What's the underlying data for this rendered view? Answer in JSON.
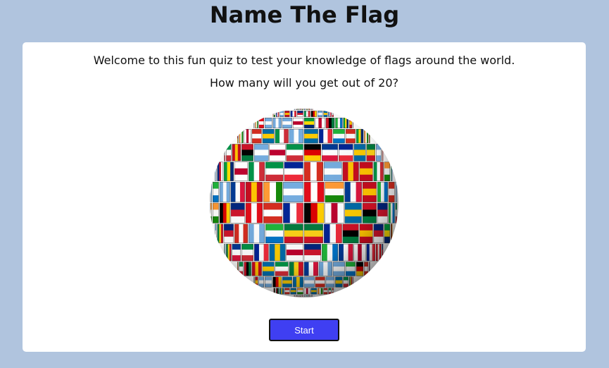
{
  "page": {
    "title": "Name The Flag"
  },
  "intro": {
    "line1": "Welcome to this fun quiz to test your knowledge of flags around the world.",
    "line2": "How many will you get out of 20?"
  },
  "globe": {
    "icon": "flag-globe-icon"
  },
  "actions": {
    "start_label": "Start"
  },
  "colors": {
    "background": "#b0c4de",
    "card": "#ffffff",
    "start_button": "#3f3ff2"
  }
}
